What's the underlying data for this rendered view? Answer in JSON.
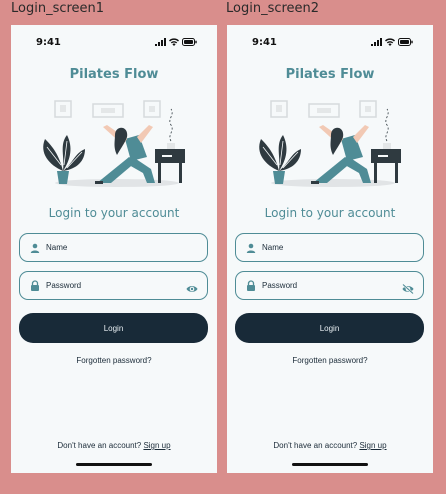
{
  "frames": [
    {
      "label": "Login_screen1",
      "time": "9:41",
      "brand": "Pilates Flow",
      "heading": "Login to your account",
      "name_placeholder": "Name",
      "password_placeholder": "Password",
      "password_toggle_icon": "eye-icon",
      "login_label": "Login",
      "forgot_label": "Forgotten password?",
      "signup_prompt": "Don't have an account?",
      "signup_link": "Sign up"
    },
    {
      "label": "Login_screen2",
      "time": "9:41",
      "brand": "Pilates Flow",
      "heading": "Login to your account",
      "name_placeholder": "Name",
      "password_placeholder": "Password",
      "password_toggle_icon": "eye-off-icon",
      "login_label": "Login",
      "forgot_label": "Forgotten password?",
      "signup_prompt": "Don't have an account?",
      "signup_link": "Sign up"
    }
  ],
  "colors": {
    "background": "#d98e8c",
    "screen": "#f6f9fa",
    "accent": "#4f8c96",
    "button": "#182a38",
    "text": "#1b2b38"
  }
}
